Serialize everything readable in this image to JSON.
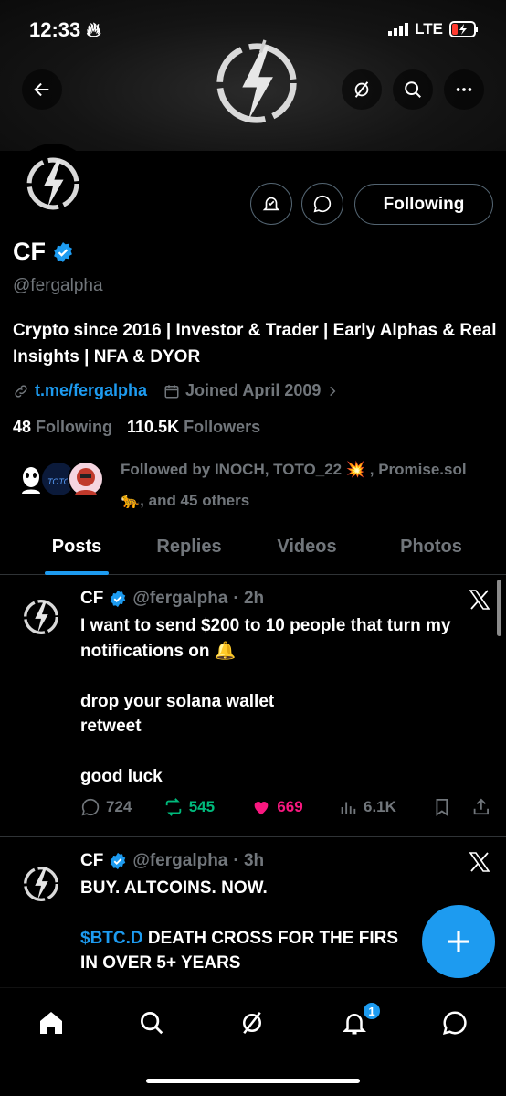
{
  "status_bar": {
    "time": "12:33",
    "network": "LTE"
  },
  "profile": {
    "name": "CF",
    "handle": "@fergalpha",
    "bio": "Crypto since 2016 | Investor & Trader | Early Alphas & Real Insights | NFA & DYOR",
    "link": "t.me/fergalpha",
    "joined": "Joined April 2009",
    "following_count": "48",
    "following_label": "Following",
    "followers_count": "110.5K",
    "followers_label": "Followers",
    "followed_by_line1": "Followed by INOCH, TOTO_22 💥 , Promise.sol",
    "followed_by_line2": "🐆, and 45 others",
    "follow_button": "Following"
  },
  "tabs": [
    {
      "label": "Posts"
    },
    {
      "label": "Replies"
    },
    {
      "label": "Videos"
    },
    {
      "label": "Photos"
    }
  ],
  "posts": [
    {
      "name": "CF",
      "handle": "@fergalpha",
      "time": "· 2h",
      "text": "I want to send $200 to 10 people that turn my notifications on 🔔\n\ndrop your solana wallet\nretweet\n\ngood luck",
      "replies": "724",
      "reposts": "545",
      "likes": "669",
      "views": "6.1K"
    },
    {
      "name": "CF",
      "handle": "@fergalpha",
      "time": "· 3h",
      "text_line1": "BUY. ALTCOINS. NOW.",
      "cashtag": "$BTC.D",
      "text_line2": " DEATH CROSS FOR THE FIRS",
      "text_line3": "IN OVER 5+ YEARS"
    }
  ],
  "notifications_badge": "1",
  "colors": {
    "accent": "#1d9bf0",
    "repost": "#00ba7c",
    "like": "#f91880",
    "muted": "#71767b"
  }
}
